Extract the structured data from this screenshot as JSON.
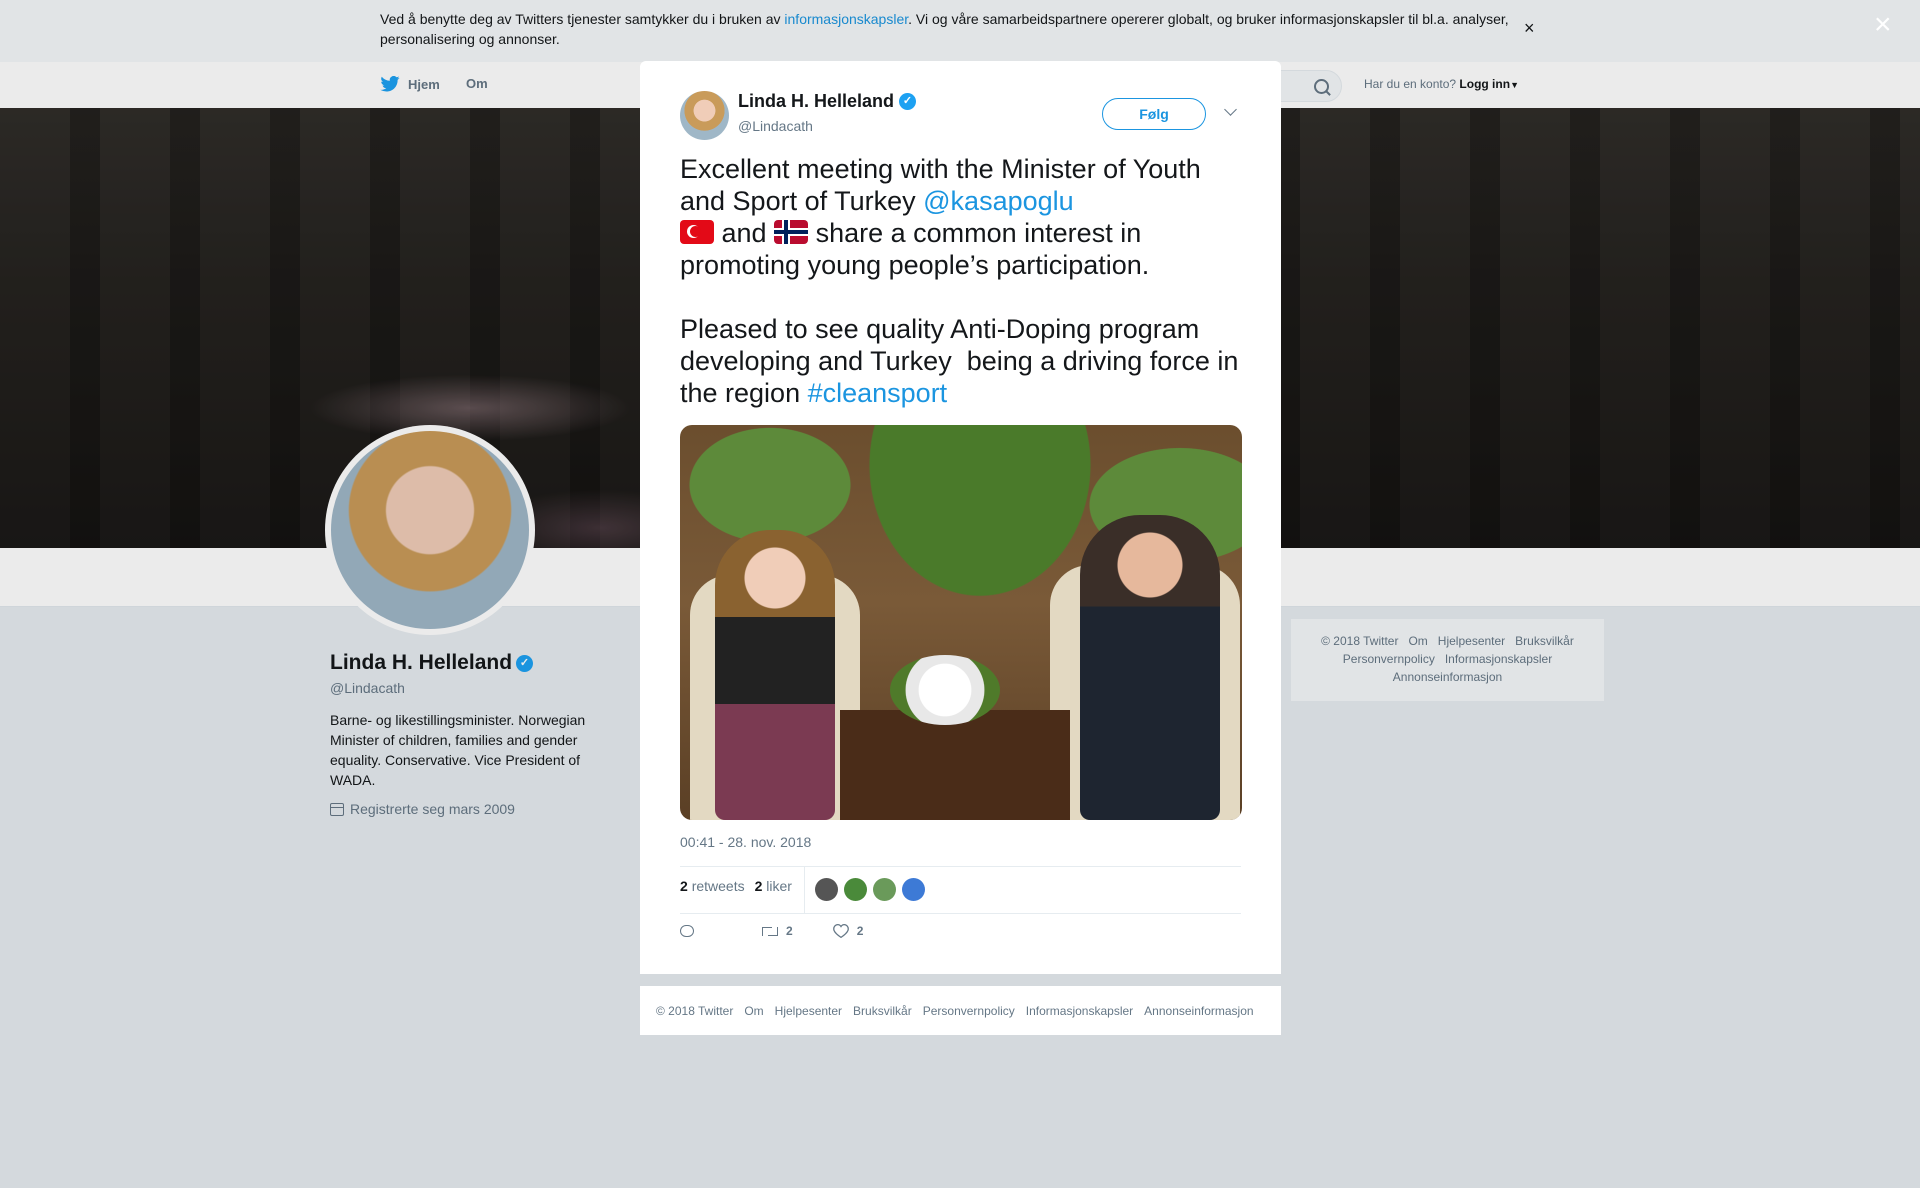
{
  "cookie": {
    "text_before": "Ved å benytte deg av Twitters tjenester samtykker du i bruken av ",
    "link": "informasjonskapsler",
    "text_after": ". Vi og våre samarbeidspartnere opererer globalt, og bruker informasjonskapsler til bl.a. analyser, personalisering og annonser.",
    "close": "×"
  },
  "nav": {
    "home": "Hjem",
    "about": "Om",
    "account_prompt": "Har du en konto?",
    "login": "Logg inn"
  },
  "profile": {
    "name": "Linda H. Helleland",
    "handle": "@Lindacath",
    "bio": "Barne- og likestillingsminister. Norwegian Minister of children, families and gender equality. Conservative. Vice President of WADA.",
    "joined": "Registrerte seg mars 2009"
  },
  "right_footer": {
    "items": [
      "© 2018 Twitter",
      "Om",
      "Hjelpesenter",
      "Bruksvilkår",
      "Personvernpolicy",
      "Informasjonskapsler",
      "Annonseinformasjon"
    ]
  },
  "tweet": {
    "author_name": "Linda H. Helleland",
    "author_handle": "@Lindacath",
    "follow_label": "Følg",
    "line1": "Excellent meeting with the Minister of Youth and Sport of Turkey ",
    "mention": "@kasapoglu",
    "and_text": " and ",
    "line2": " share a common interest in promoting young people’s participation.",
    "line3": "Pleased to see quality Anti-Doping program developing and Turkey  being a driving force in the region ",
    "hashtag": "#cleansport",
    "timestamp": "00:41 - 28. nov. 2018",
    "retweets_count": "2",
    "retweets_label": "retweets",
    "likes_count": "2",
    "likes_label": "liker",
    "action_retweet_count": "2",
    "action_like_count": "2",
    "liker_colors": [
      "#555555",
      "#4a8a3a",
      "#6a9a5a",
      "#3d7ad6"
    ]
  },
  "modal_footer": {
    "items": [
      "© 2018 Twitter",
      "Om",
      "Hjelpesenter",
      "Bruksvilkår",
      "Personvernpolicy",
      "Informasjonskapsler",
      "Annonseinformasjon"
    ]
  },
  "close_overlay": "×",
  "colors": {
    "link": "#1b95e0",
    "verified": "#1da1f2",
    "backdrop": "#e6ecf0"
  }
}
